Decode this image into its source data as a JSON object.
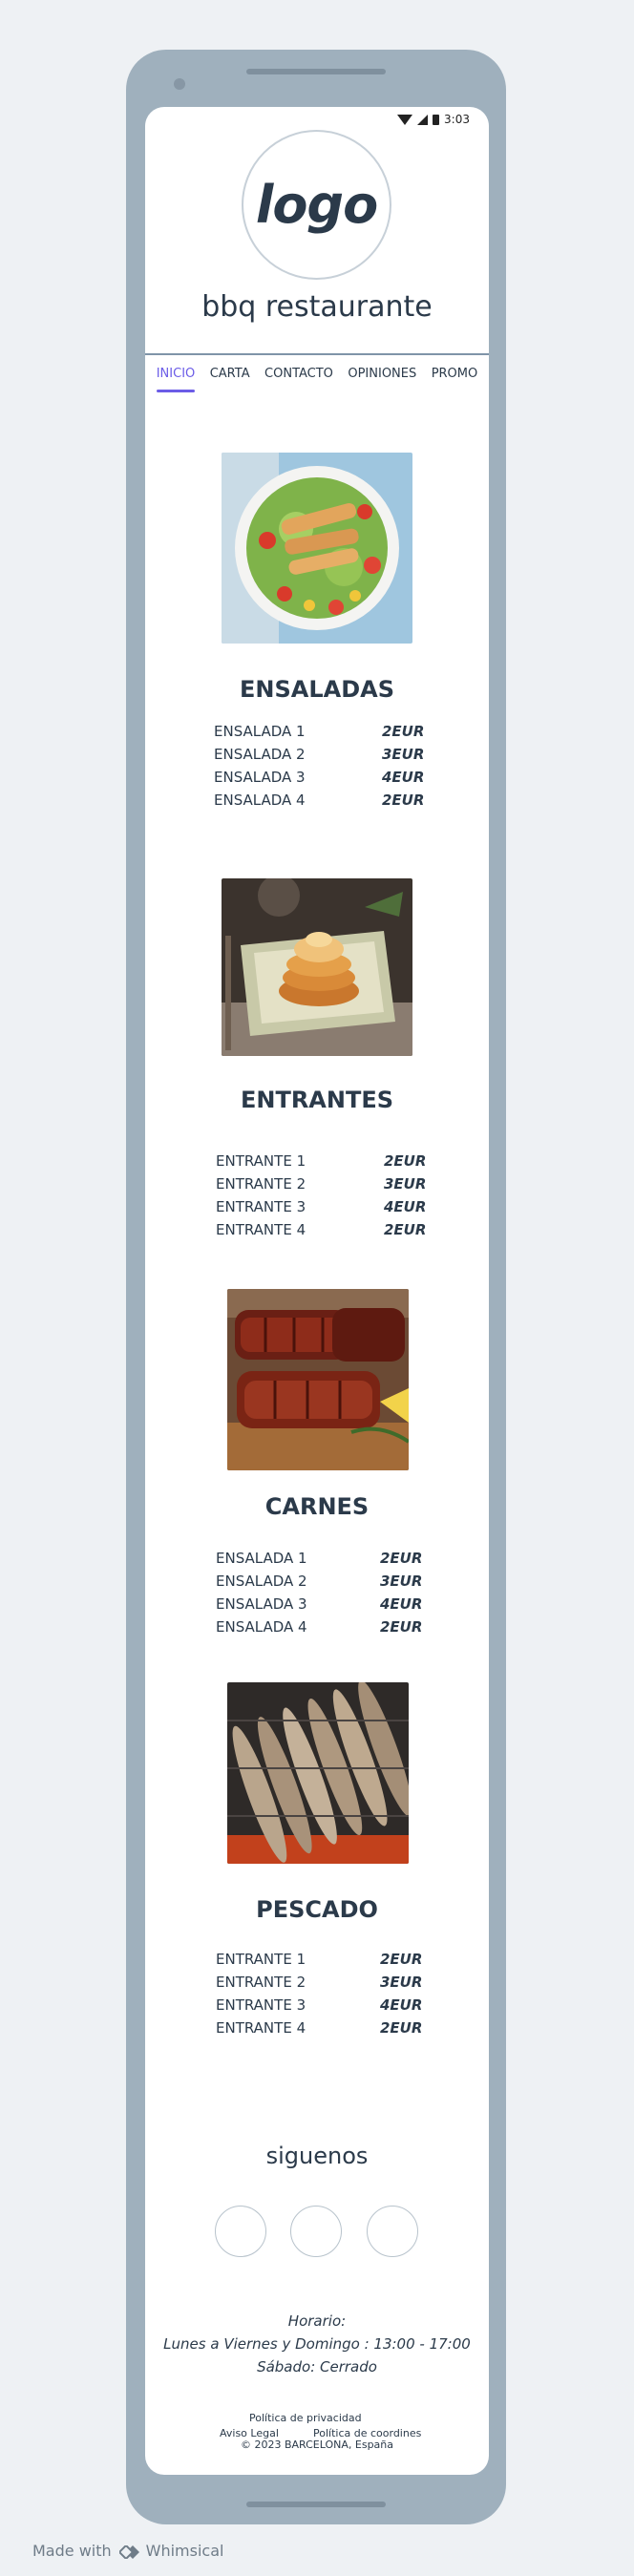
{
  "status_bar": {
    "time": "3:03"
  },
  "header": {
    "logo_text": "logo",
    "restaurant_name": "bbq restaurante"
  },
  "nav": {
    "items": [
      {
        "label": "INICIO",
        "active": true
      },
      {
        "label": "CARTA",
        "active": false
      },
      {
        "label": "CONTACTO",
        "active": false
      },
      {
        "label": "OPINIONES",
        "active": false
      },
      {
        "label": "PROMO",
        "active": false
      }
    ]
  },
  "sections": [
    {
      "title": "ENSALADAS",
      "image": "salad-photo",
      "items": [
        {
          "name": "ENSALADA 1",
          "price": "2EUR"
        },
        {
          "name": "ENSALADA 2",
          "price": "3EUR"
        },
        {
          "name": "ENSALADA 3",
          "price": "4EUR"
        },
        {
          "name": "ENSALADA 4",
          "price": "2EUR"
        }
      ]
    },
    {
      "title": "ENTRANTES",
      "image": "starter-photo",
      "items": [
        {
          "name": "ENTRANTE 1",
          "price": "2EUR"
        },
        {
          "name": "ENTRANTE 2",
          "price": "3EUR"
        },
        {
          "name": "ENTRANTE 3",
          "price": "4EUR"
        },
        {
          "name": "ENTRANTE 4",
          "price": "2EUR"
        }
      ]
    },
    {
      "title": "CARNES",
      "image": "ribs-photo",
      "items": [
        {
          "name": "ENSALADA 1",
          "price": "2EUR"
        },
        {
          "name": "ENSALADA 2",
          "price": "3EUR"
        },
        {
          "name": "ENSALADA 3",
          "price": "4EUR"
        },
        {
          "name": "ENSALADA 4",
          "price": "2EUR"
        }
      ]
    },
    {
      "title": "PESCADO",
      "image": "grilled-fish-photo",
      "items": [
        {
          "name": "ENTRANTE 1",
          "price": "2EUR"
        },
        {
          "name": "ENTRANTE 2",
          "price": "3EUR"
        },
        {
          "name": "ENTRANTE 3",
          "price": "4EUR"
        },
        {
          "name": "ENTRANTE 4",
          "price": "2EUR"
        }
      ]
    }
  ],
  "social": {
    "title": "siguenos",
    "buttons": [
      "social-button-1",
      "social-button-2",
      "social-button-3"
    ]
  },
  "footer": {
    "horario_title": "Horario:",
    "horario_line1": "Lunes a Viernes y Domingo : 13:00 - 17:00",
    "horario_line2": "Sábado: Cerrado",
    "privacy": "Política de privacidad",
    "legal": "Aviso Legal",
    "cookies": "Política de coordines",
    "copyright": "© 2023 BARCELONA, España"
  },
  "watermark": {
    "made_with": "Made with",
    "brand": "Whimsical"
  },
  "colors": {
    "accent": "#6b5ce7",
    "text": "#2b3a4a",
    "device_frame": "#9fb0bd",
    "background": "#eef1f4"
  }
}
